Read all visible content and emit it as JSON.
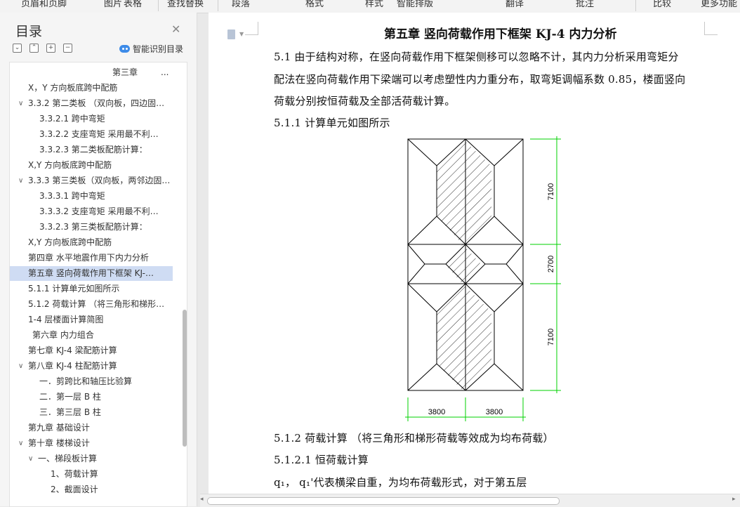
{
  "toolbar": {
    "items": [
      "页眉和页脚",
      "图片",
      "表格",
      "查找替换",
      "段落",
      "格式",
      "样式",
      "智能排版",
      "翻译",
      "批注",
      "比较",
      "更多功能"
    ]
  },
  "nav": {
    "title": "目录",
    "smart_label": "智能识别目录",
    "items": [
      {
        "text": "第三章",
        "indent": 1,
        "caret": "",
        "ellipsis": "..."
      },
      {
        "text": "X，Y 方向板底跨中配筋",
        "indent": 0,
        "caret": ""
      },
      {
        "text": "3.3.2  第二类板 （双向板，四边固…",
        "indent": 0,
        "caret": "v"
      },
      {
        "text": "3.3.2.1 跨中弯矩",
        "indent": 2,
        "caret": ""
      },
      {
        "text": "3.3.2.2 支座弯矩    采用最不利…",
        "indent": 2,
        "caret": ""
      },
      {
        "text": "3.3.2.3     第二类板配筋计算：",
        "indent": 2,
        "caret": ""
      },
      {
        "text": "X,Y 方向板底跨中配筋",
        "indent": 0,
        "caret": ""
      },
      {
        "text": "3.3.3 第三类板（双向板，两邻边固…",
        "indent": 0,
        "caret": "v"
      },
      {
        "text": "3.3.3.1 跨中弯矩",
        "indent": 2,
        "caret": ""
      },
      {
        "text": "3.3.3.2  支座弯矩    采用最不利…",
        "indent": 2,
        "caret": ""
      },
      {
        "text": "3.3.2.3     第三类板配筋计算：",
        "indent": 2,
        "caret": ""
      },
      {
        "text": "X,Y 方向板底跨中配筋",
        "indent": 0,
        "caret": ""
      },
      {
        "text": "第四章     水平地震作用下内力分析",
        "indent": 0,
        "caret": ""
      },
      {
        "text": "第五章     竖向荷载作用下框架 KJ-…",
        "indent": 0,
        "caret": "",
        "active": true
      },
      {
        "text": "5.1.1 计算单元如图所示",
        "indent": 0,
        "caret": ""
      },
      {
        "text": "5.1.2  荷载计算 （将三角形和梯形…",
        "indent": 0,
        "caret": ""
      },
      {
        "text": "1-4 层楼面计算简图",
        "indent": 0,
        "caret": ""
      },
      {
        "text": "第六章       内力组合",
        "indent": 0.5,
        "caret": ""
      },
      {
        "text": "第七章     KJ-4 梁配筋计算",
        "indent": 0,
        "caret": ""
      },
      {
        "text": "第八章    KJ-4 柱配筋计算",
        "indent": 0,
        "caret": "v"
      },
      {
        "text": "一．剪跨比和轴压比验算",
        "indent": 2,
        "caret": ""
      },
      {
        "text": "二．第一层     B 柱",
        "indent": 2,
        "caret": ""
      },
      {
        "text": "三．第三层    B 柱",
        "indent": 2,
        "caret": ""
      },
      {
        "text": "第九章    基础设计",
        "indent": 0,
        "caret": ""
      },
      {
        "text": "第十章    楼梯设计",
        "indent": 0,
        "caret": "v"
      },
      {
        "text": "一、梯段板计算",
        "indent": 1,
        "caret": "v"
      },
      {
        "text": "1、荷载计算",
        "indent": 3,
        "caret": ""
      },
      {
        "text": "2、截面设计",
        "indent": 3,
        "caret": ""
      }
    ]
  },
  "document": {
    "chapter_title": "第五章      竖向荷载作用下框架 KJ-4 内力分析",
    "para_5_1_line1": "5.1 由于结构对称，在竖向荷载作用下框架侧移可以忽略不计，其内力分析采用弯矩分",
    "para_5_1_line2": "配法在竖向荷载作用下梁端可以考虑塑性内力重分布，取弯矩调幅系数 0.85，楼面竖向",
    "para_5_1_line3": "荷载分别按恒荷载及全部活荷载计算。",
    "heading_5_1_1": "5.1.1 计算单元如图所示",
    "heading_5_1_2": "5.1.2  荷载计算 （将三角形和梯形荷载等效成为均布荷载）",
    "heading_5_1_2_1": "5.1.2.1  恒荷载计算",
    "para_q": "q₁，   q₁'代表横梁自重，为均布荷载形式，对于第五层"
  },
  "figure": {
    "dim_top": "7100",
    "dim_mid": "2700",
    "dim_bot": "7100",
    "dim_left": "3800",
    "dim_right": "3800",
    "dim_color": "#00d000"
  }
}
